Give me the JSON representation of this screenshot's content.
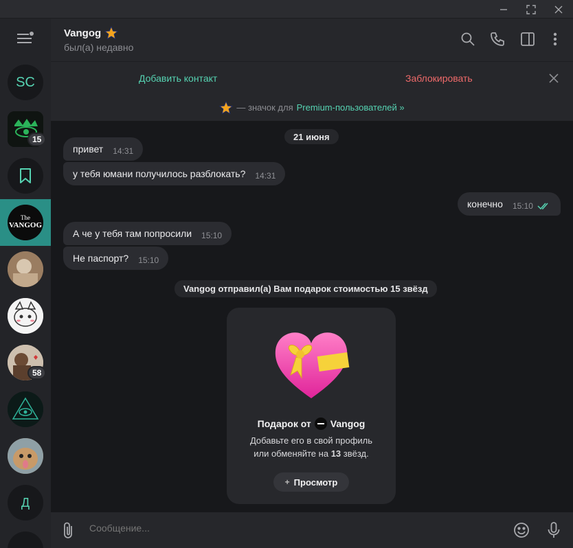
{
  "window": {
    "buttons": [
      "minimize",
      "maximize",
      "close"
    ]
  },
  "rail": {
    "items": [
      {
        "initials": "SC",
        "color": "#56d3b2"
      },
      {
        "badge": "15"
      },
      {
        "icon": "bookmark-icon"
      },
      {
        "text": "The Vangog",
        "active": true
      },
      {},
      {},
      {
        "badge": "58"
      },
      {},
      {},
      {
        "initials": "Д",
        "color": "#56d3b2"
      }
    ]
  },
  "header": {
    "name": "Vangog",
    "status": "был(а) недавно"
  },
  "actions": {
    "add_contact": "Добавить контакт",
    "block": "Заблокировать"
  },
  "premium": {
    "prefix": "— значок для",
    "link": "Premium-пользователей »"
  },
  "messages": {
    "date": "21 июня",
    "items": [
      {
        "text": "привет",
        "time": "14:31",
        "dir": "in"
      },
      {
        "text": "у тебя юмани получилось разблокать?",
        "time": "14:31",
        "dir": "in"
      },
      {
        "text": "конечно",
        "time": "15:10",
        "dir": "out"
      },
      {
        "text": "А че у тебя там попросили",
        "time": "15:10",
        "dir": "in"
      },
      {
        "text": "Не паспорт?",
        "time": "15:10",
        "dir": "in"
      }
    ],
    "service": "Vangog отправил(а) Вам подарок стоимостью 15 звёзд"
  },
  "gift": {
    "title_prefix": "Подарок от",
    "title_name": "Vangog",
    "desc_line1": "Добавьте его в свой профиль",
    "desc_line2_prefix": "или обменяйте на",
    "desc_count": "13",
    "desc_line2_suffix": "звёзд.",
    "view": "Просмотр"
  },
  "composer": {
    "placeholder": "Сообщение..."
  },
  "colors": {
    "accent": "#56d3b2",
    "danger": "#ef6a6a",
    "active_chat": "#2a8f86",
    "read_check": "#56d3b2"
  }
}
